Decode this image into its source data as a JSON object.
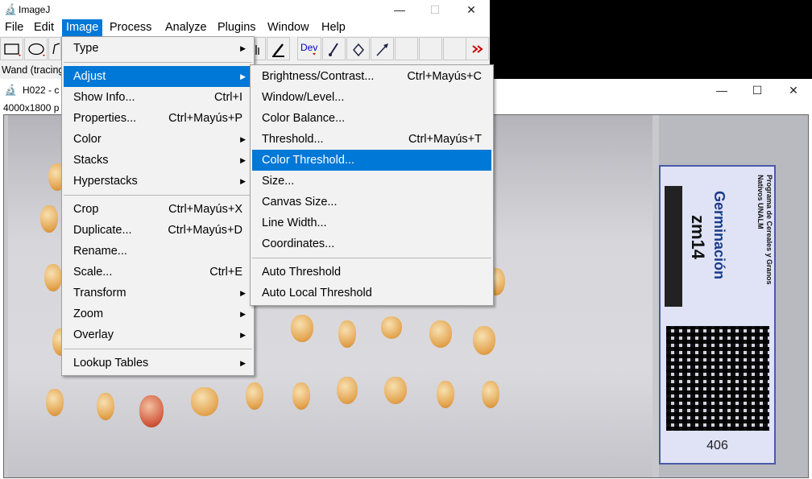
{
  "main_window": {
    "title": "ImageJ",
    "menus": [
      "File",
      "Edit",
      "Image",
      "Process",
      "Analyze",
      "Plugins",
      "Window",
      "Help"
    ],
    "active_menu": "Image",
    "toolbar_dev_label": "Dev",
    "status": "Wand (tracing"
  },
  "image_window": {
    "title": "H022 - c",
    "info": "4000x1800 p"
  },
  "label_card": {
    "org": "Programa de Cereales y Granos Nativos UNALM",
    "heading": "Germinación",
    "code": "zm14",
    "number": "406"
  },
  "image_menu": {
    "items": [
      {
        "label": "Type",
        "shortcut": "",
        "submenu": true
      },
      {
        "label": "Adjust",
        "shortcut": "",
        "submenu": true,
        "selected": true
      },
      {
        "label": "Show Info...",
        "shortcut": "Ctrl+I"
      },
      {
        "label": "Properties...",
        "shortcut": "Ctrl+Mayús+P"
      },
      {
        "label": "Color",
        "shortcut": "",
        "submenu": true
      },
      {
        "label": "Stacks",
        "shortcut": "",
        "submenu": true
      },
      {
        "label": "Hyperstacks",
        "shortcut": "",
        "submenu": true
      },
      {
        "label": "Crop",
        "shortcut": "Ctrl+Mayús+X"
      },
      {
        "label": "Duplicate...",
        "shortcut": "Ctrl+Mayús+D"
      },
      {
        "label": "Rename...",
        "shortcut": ""
      },
      {
        "label": "Scale...",
        "shortcut": "Ctrl+E"
      },
      {
        "label": "Transform",
        "shortcut": "",
        "submenu": true
      },
      {
        "label": "Zoom",
        "shortcut": "",
        "submenu": true
      },
      {
        "label": "Overlay",
        "shortcut": "",
        "submenu": true
      },
      {
        "label": "Lookup Tables",
        "shortcut": "",
        "submenu": true
      }
    ]
  },
  "adjust_menu": {
    "items": [
      {
        "label": "Brightness/Contrast...",
        "shortcut": "Ctrl+Mayús+C"
      },
      {
        "label": "Window/Level...",
        "shortcut": ""
      },
      {
        "label": "Color Balance...",
        "shortcut": ""
      },
      {
        "label": "Threshold...",
        "shortcut": "Ctrl+Mayús+T"
      },
      {
        "label": "Color Threshold...",
        "shortcut": "",
        "selected": true
      },
      {
        "label": "Size...",
        "shortcut": ""
      },
      {
        "label": "Canvas Size...",
        "shortcut": ""
      },
      {
        "label": "Line Width...",
        "shortcut": ""
      },
      {
        "label": "Coordinates...",
        "shortcut": ""
      },
      {
        "label": "Auto Threshold",
        "shortcut": ""
      },
      {
        "label": "Auto Local Threshold",
        "shortcut": ""
      }
    ]
  },
  "colors": {
    "selection": "#0078d7",
    "menu_bg": "#f2f2f2"
  }
}
